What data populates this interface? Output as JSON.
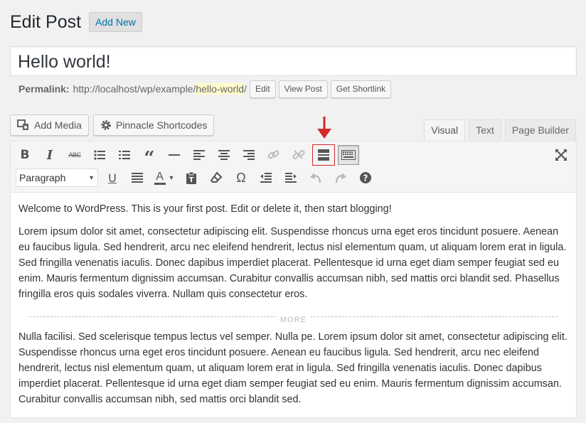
{
  "header": {
    "title": "Edit Post",
    "add_new": "Add New"
  },
  "post": {
    "title": "Hello world!"
  },
  "permalink": {
    "label": "Permalink:",
    "base": "http://localhost/wp/example/",
    "slug": "hello-world",
    "suffix": "/",
    "buttons": [
      "Edit",
      "View Post",
      "Get Shortlink"
    ]
  },
  "media": {
    "add_media": "Add Media",
    "shortcodes": "Pinnacle Shortcodes"
  },
  "tabs": [
    "Visual",
    "Text",
    "Page Builder"
  ],
  "toolbar": {
    "format_select": "Paragraph",
    "text_color_label": "A",
    "highlight_color": "#d02a2a"
  },
  "content": {
    "p1": "Welcome to WordPress. This is your first post. Edit or delete it, then start blogging!",
    "p2": "Lorem ipsum dolor sit amet, consectetur adipiscing elit. Suspendisse rhoncus urna eget eros tincidunt posuere. Aenean eu faucibus ligula. Sed hendrerit, arcu nec eleifend hendrerit, lectus nisl elementum quam, ut aliquam lorem erat in ligula. Sed fringilla venenatis iaculis. Donec dapibus imperdiet placerat. Pellentesque id urna eget diam semper feugiat sed eu enim. Mauris fermentum dignissim accumsan. Curabitur convallis accumsan nibh, sed mattis orci blandit sed. Phasellus fringilla eros quis sodales viverra. Nullam quis consectetur eros.",
    "more": "MORE",
    "p3": "Nulla facilisi. Sed scelerisque tempus lectus vel semper. Nulla pe. Lorem ipsum dolor sit amet, consectetur adipiscing elit. Suspendisse rhoncus urna eget eros tincidunt posuere. Aenean eu faucibus ligula. Sed hendrerit, arcu nec eleifend hendrerit, lectus nisl elementum quam, ut aliquam lorem erat in ligula. Sed fringilla venenatis iaculis. Donec dapibus imperdiet placerat. Pellentesque id urna eget diam semper feugiat sed eu enim. Mauris fermentum dignissim accumsan. Curabitur convallis accumsan nibh, sed mattis orci blandit sed."
  }
}
